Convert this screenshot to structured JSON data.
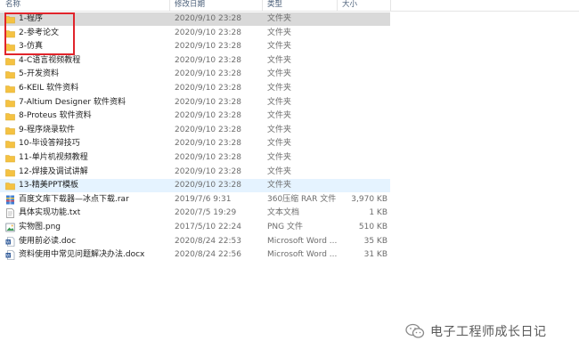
{
  "columns": {
    "name": "名称",
    "modified": "修改日期",
    "type": "类型",
    "size": "大小"
  },
  "sort_indicator": "^",
  "rows": [
    {
      "name": "1-程序",
      "date": "2020/9/10 23:28",
      "type": "文件夹",
      "size": "",
      "icon": "folder-icon"
    },
    {
      "name": "2-参考论文",
      "date": "2020/9/10 23:28",
      "type": "文件夹",
      "size": "",
      "icon": "folder-icon"
    },
    {
      "name": "3-仿真",
      "date": "2020/9/10 23:28",
      "type": "文件夹",
      "size": "",
      "icon": "folder-icon"
    },
    {
      "name": "4-C语言视频教程",
      "date": "2020/9/10 23:28",
      "type": "文件夹",
      "size": "",
      "icon": "folder-icon"
    },
    {
      "name": "5-开发资料",
      "date": "2020/9/10 23:28",
      "type": "文件夹",
      "size": "",
      "icon": "folder-icon"
    },
    {
      "name": "6-KEIL 软件资料",
      "date": "2020/9/10 23:28",
      "type": "文件夹",
      "size": "",
      "icon": "folder-icon"
    },
    {
      "name": "7-Altium Designer 软件资料",
      "date": "2020/9/10 23:28",
      "type": "文件夹",
      "size": "",
      "icon": "folder-icon"
    },
    {
      "name": "8-Proteus 软件资料",
      "date": "2020/9/10 23:28",
      "type": "文件夹",
      "size": "",
      "icon": "folder-icon"
    },
    {
      "name": "9-程序烧录软件",
      "date": "2020/9/10 23:28",
      "type": "文件夹",
      "size": "",
      "icon": "folder-icon"
    },
    {
      "name": "10-毕设答辩技巧",
      "date": "2020/9/10 23:28",
      "type": "文件夹",
      "size": "",
      "icon": "folder-icon"
    },
    {
      "name": "11-单片机视频教程",
      "date": "2020/9/10 23:28",
      "type": "文件夹",
      "size": "",
      "icon": "folder-icon"
    },
    {
      "name": "12-焊接及调试讲解",
      "date": "2020/9/10 23:28",
      "type": "文件夹",
      "size": "",
      "icon": "folder-icon"
    },
    {
      "name": "13-精美PPT模板",
      "date": "2020/9/10 23:28",
      "type": "文件夹",
      "size": "",
      "icon": "folder-icon"
    },
    {
      "name": "百度文库下载器—冰点下载.rar",
      "date": "2019/7/6 9:31",
      "type": "360压缩 RAR 文件",
      "size": "3,970 KB",
      "icon": "rar-file-icon"
    },
    {
      "name": "具体实现功能.txt",
      "date": "2020/7/5 19:29",
      "type": "文本文档",
      "size": "1 KB",
      "icon": "text-file-icon"
    },
    {
      "name": "实物图.png",
      "date": "2017/5/10 22:24",
      "type": "PNG 文件",
      "size": "510 KB",
      "icon": "image-file-icon"
    },
    {
      "name": "使用前必读.doc",
      "date": "2020/8/24 22:53",
      "type": "Microsoft Word ...",
      "size": "35 KB",
      "icon": "word-file-icon"
    },
    {
      "name": "资料使用中常见问题解决办法.docx",
      "date": "2020/8/24 22:56",
      "type": "Microsoft Word ...",
      "size": "31 KB",
      "icon": "word-file-icon"
    }
  ],
  "watermark": "电子工程师成长日记",
  "colors": {
    "folder": "#f5c242",
    "highlight_border": "#e0242b",
    "selected_row": "#d9d9d9",
    "hover_row": "#e5f3ff"
  }
}
